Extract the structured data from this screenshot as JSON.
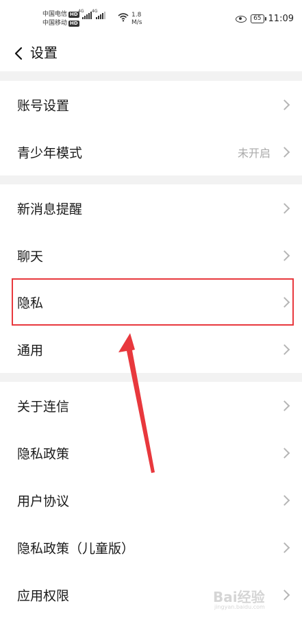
{
  "status_bar": {
    "carrier1": "中国电信",
    "carrier2": "中国移动",
    "hd": "HD",
    "net1": "4G",
    "net2": "4G",
    "speed_value": "1.8",
    "speed_unit": "M/s",
    "battery": "65",
    "time": "11:09"
  },
  "header": {
    "title": "设置"
  },
  "sections": [
    [
      {
        "label": "账号设置",
        "value": ""
      },
      {
        "label": "青少年模式",
        "value": "未开启"
      }
    ],
    [
      {
        "label": "新消息提醒",
        "value": ""
      },
      {
        "label": "聊天",
        "value": ""
      },
      {
        "label": "隐私",
        "value": ""
      },
      {
        "label": "通用",
        "value": ""
      }
    ],
    [
      {
        "label": "关于连信",
        "value": ""
      },
      {
        "label": "隐私政策",
        "value": ""
      },
      {
        "label": "用户协议",
        "value": ""
      },
      {
        "label": "隐私政策（儿童版）",
        "value": ""
      },
      {
        "label": "应用权限",
        "value": ""
      }
    ]
  ],
  "annotation": {
    "highlight_color": "#e8383d"
  },
  "watermark": {
    "text": "Bai经验",
    "sub": "jingyan.baidu.com"
  }
}
